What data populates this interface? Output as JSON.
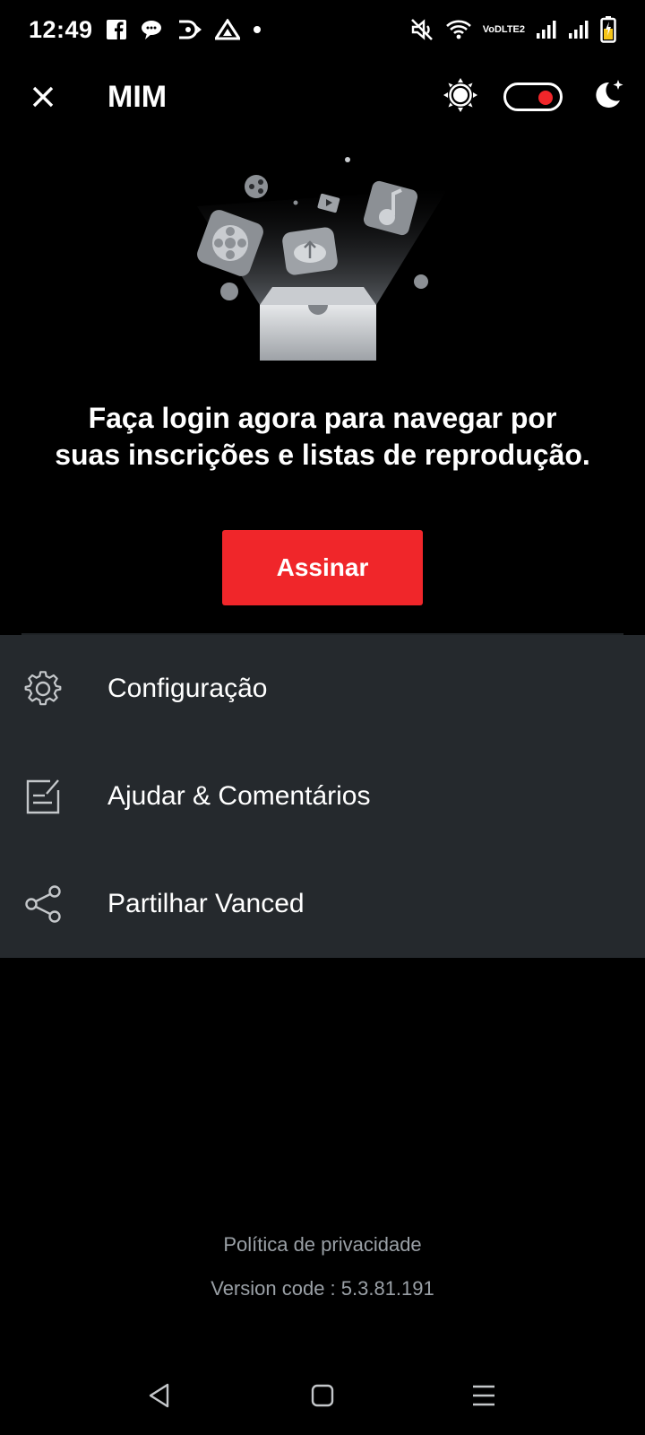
{
  "status_bar": {
    "time": "12:49",
    "volte_top": "VoD",
    "volte_bottom": "LTE2",
    "icons": [
      "facebook-icon",
      "chat-bubble-icon",
      "sync-app-icon",
      "warning-triangle-icon",
      "dot-icon",
      "mute-icon",
      "wifi-icon",
      "signal-icon",
      "signal-icon",
      "battery-icon"
    ]
  },
  "app_bar": {
    "title": "MIM",
    "close_icon": "close-icon",
    "light_icon": "sun-icon",
    "dark_icon": "moon-icon",
    "toggle_color": "#f0262a"
  },
  "hero": {
    "message": "Faça login agora para navegar por suas inscrições e listas de reprodução.",
    "button_label": "Assinar",
    "button_color": "#f0262a"
  },
  "menu": {
    "items": [
      {
        "label": "Configuração",
        "icon": "gear-icon"
      },
      {
        "label": "Ajudar & Comentários",
        "icon": "feedback-icon"
      },
      {
        "label": "Partilhar Vanced",
        "icon": "share-icon"
      }
    ]
  },
  "footer": {
    "privacy": "Política de privacidade",
    "version": "Version code : 5.3.81.191"
  },
  "nav_bar": {
    "icons": [
      "back-icon",
      "home-icon",
      "recents-icon"
    ]
  }
}
